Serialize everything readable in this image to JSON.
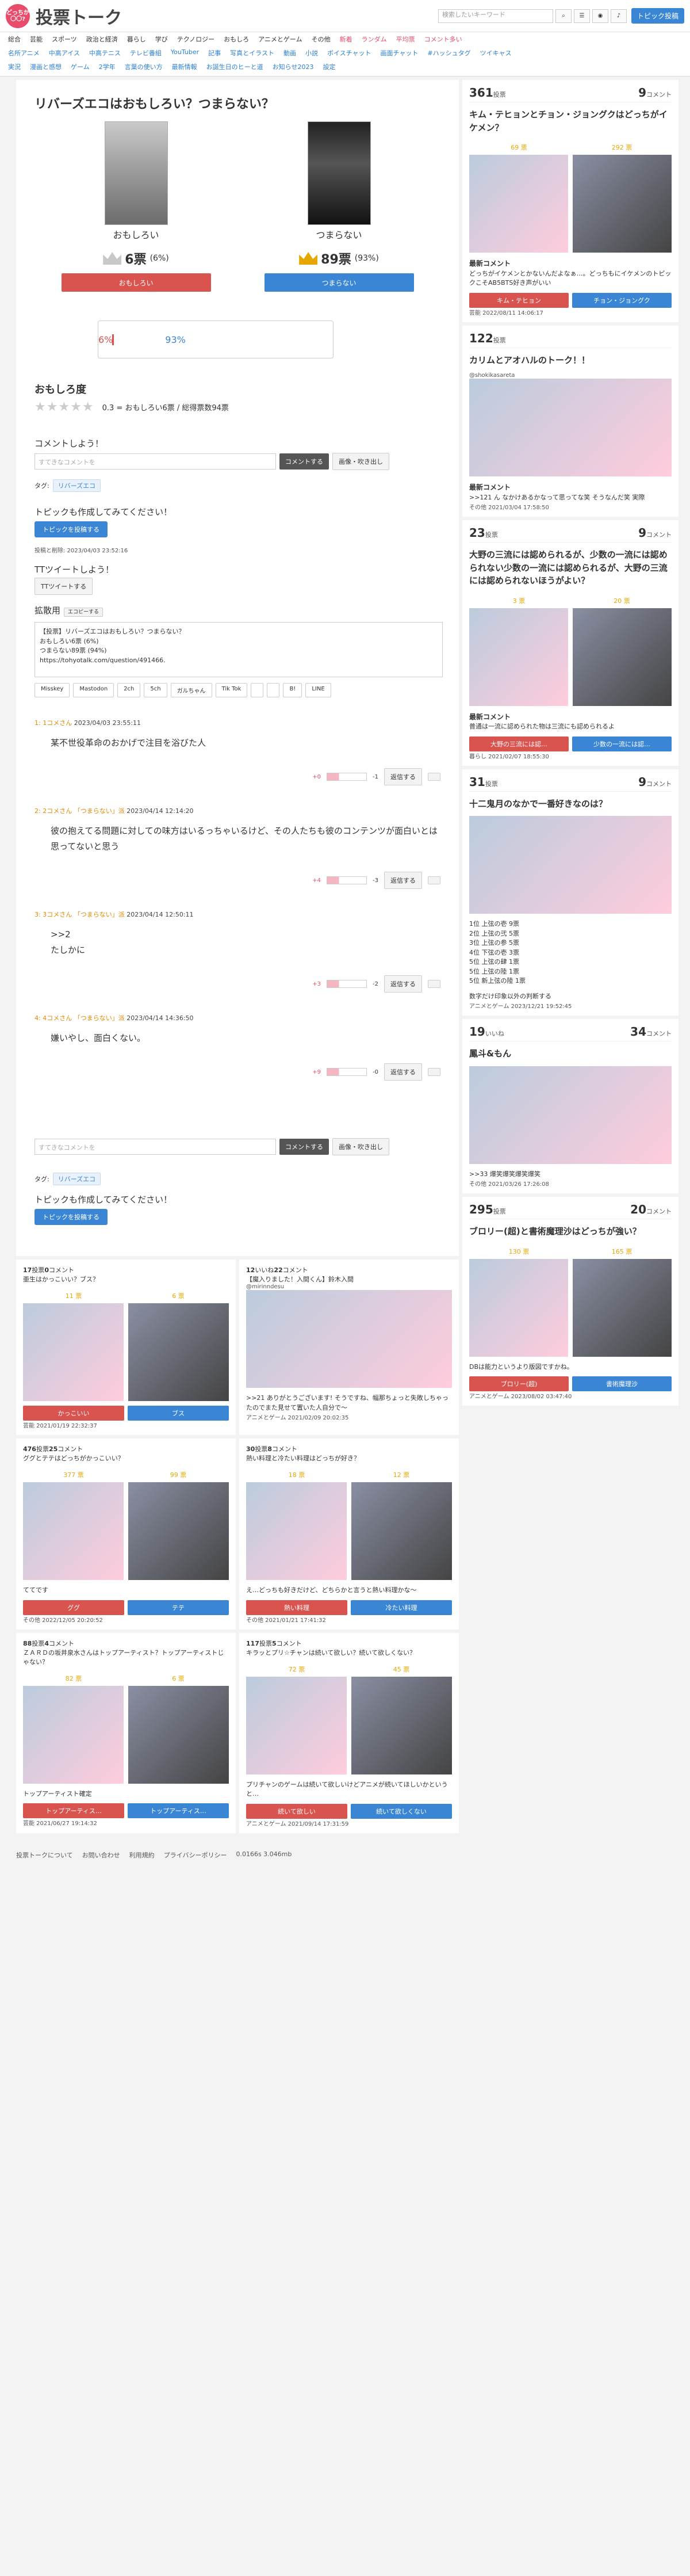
{
  "header": {
    "logo_badge": "どっちが〇〇?",
    "logo": "投票トーク",
    "search_placeholder": "検索したいキーワード",
    "post_button": "トピック投稿"
  },
  "nav": {
    "row1": [
      "総合",
      "芸能",
      "スポーツ",
      "政治と経済",
      "暮らし",
      "学び",
      "テクノロジー",
      "おもしろ",
      "アニメとゲーム",
      "その他",
      "新着",
      "ランダム",
      "平均票",
      "コメント多い"
    ],
    "row2": [
      "名所アニメ",
      "中高アイス",
      "中高テニス",
      "テレビ番組",
      "YouTuber",
      "記事",
      "写真とイラスト",
      "動画",
      "小説",
      "ボイスチャット",
      "画面チャット",
      "#ハッシュタグ",
      "ツイキャス"
    ],
    "row3": [
      "実況",
      "漫画と感想",
      "ゲーム",
      "2学年",
      "言葉の使い方",
      "最新情報",
      "お誕生日のヒーと道",
      "お知らせ2023",
      "設定"
    ]
  },
  "topic": {
    "title": "リバーズエコはおもしろい？つまらない？",
    "option_a": {
      "name": "おもしろい",
      "votes": "6票",
      "pct": "(6%)",
      "button": "おもしろい"
    },
    "option_b": {
      "name": "つまらない",
      "votes": "89票",
      "pct": "(93%)",
      "button": "つまらない"
    },
    "bar_a": "6%",
    "bar_b": "93%",
    "rating_heading": "おもしろ度",
    "stars": "★★★★★",
    "rating_text": "0.3 = おもしろい6票 / 総得票数94票",
    "comment_heading": "コメントしよう！",
    "comment_placeholder": "すてきなコメントを",
    "comment_button": "コメントする",
    "image_button": "画像・吹き出し",
    "tag_label": "タグ:",
    "tag": "リバーズエコ",
    "create_heading": "トピックも作成してみてください！",
    "create_button": "トピックを投稿する",
    "post_meta": "投稿と削除: 2023/04/03 23:52:16",
    "tweet_heading": "TTツイートしよう！",
    "tweet_button": "TTツイートする",
    "share_heading": "拡散用",
    "share_button": "エコピーする",
    "embed_text": "【投票】リバーズエコはおもしろい？つまらない？\nおもしろい6票 (6%)\nつまらない89票 (94%)\nhttps://tohyotalk.com/question/491466.",
    "shares": [
      "Misskey",
      "Mastodon",
      "2ch",
      "5ch",
      "ガルちゃん",
      "Tik Tok",
      "",
      "",
      "B!",
      "LINE"
    ]
  },
  "comments": [
    {
      "num": "1:",
      "author": "1コメさん",
      "date": "2023/04/03 23:55:11",
      "body": "某不世役革命のおかげで注目を浴びた人",
      "plus": "+0",
      "minus": "-1",
      "reply": "返信する"
    },
    {
      "num": "2:",
      "author": "2コメさん",
      "side": "「つまらない」派",
      "date": "2023/04/14 12:14:20",
      "body": "彼の抱えてる問題に対しての味方はいるっちゃいるけど、その人たちも彼のコンテンツが面白いとは思ってないと思う",
      "plus": "+4",
      "minus": "-3",
      "reply": "返信する"
    },
    {
      "num": "3:",
      "author": "3コメさん",
      "side": "「つまらない」派",
      "date": "2023/04/14 12:50:11",
      "body": ">>2\nたしかに",
      "plus": "+3",
      "minus": "-2",
      "reply": "返信する"
    },
    {
      "num": "4:",
      "author": "4コメさん",
      "side": "「つまらない」派",
      "date": "2023/04/14 14:36:50",
      "body": "嫌いやし、面白くない。",
      "plus": "+9",
      "minus": "-0",
      "reply": "返信する"
    }
  ],
  "side_cards": [
    {
      "votes": "361",
      "votes_label": "投票",
      "comments": "9",
      "comments_label": "コメント",
      "title": "キム・テヒョンとチョン・ジョングクはどっちがイケメン？",
      "a_votes": "69 票",
      "b_votes": "292 票",
      "a": "キム・テヒョン",
      "b": "チョン・ジョングク",
      "latest_label": "最新コメント",
      "latest": "どっちがイケメンとかないんだよなぁ…。どっちもにイケメンのトピックこそAB5BTS好き声がいい",
      "date": "芸能 2022/08/11 14:06:17"
    },
    {
      "votes": "122",
      "votes_label": "投票",
      "title": "カリムとアオハルのトーク！！",
      "author": "@shokikasareta",
      "latest_label": "最新コメント",
      "latest": ">>121 ん なかけあるかなって思ってな笑 そうなんだ笑 実際",
      "date": "その他 2021/03/04 17:58:50"
    },
    {
      "votes": "23",
      "votes_label": "投票",
      "comments": "9",
      "comments_label": "コメント",
      "title": "大野の三流には認められるが、少数の一流には認められない少数の一流には認められるが、大野の三流には認められないほうがよい？",
      "a_votes": "3 票",
      "b_votes": "20 票",
      "latest_label": "最新コメント",
      "latest": "普通は一流に認められた物は三流にも認められるよ",
      "a": "大野の三流には認…",
      "b": "少数の一流には認…",
      "date": "暮らし 2021/02/07 18:55:30"
    },
    {
      "votes": "31",
      "votes_label": "投票",
      "comments": "9",
      "comments_label": "コメント",
      "title": "十二鬼月のなかで一番好きなのは？",
      "list": [
        "1位 上弦の壱 9票",
        "2位 上弦の弐 5票",
        "3位 上弦の参 5票",
        "4位 下弦の壱 3票",
        "5位 上弦の肆 1票",
        "5位 上弦の陸 1票",
        "5位 新上弦の陸 1票"
      ],
      "latest": "数字だけ印象以外の判断する",
      "date": "アニメとゲーム 2023/12/21 19:52:45"
    },
    {
      "votes": "19",
      "votes_label": "いいね",
      "comments": "34",
      "comments_label": "コメント",
      "title": "鳳斗&もん",
      "latest": ">>33 爆笑爆笑爆笑爆笑",
      "date": "その他 2021/03/26 17:26:08"
    },
    {
      "votes": "295",
      "votes_label": "投票",
      "comments": "20",
      "comments_label": "コメント",
      "title": "ブロリー(超)と書術魔理沙はどっちが強い？",
      "a_votes": "130 票",
      "b_votes": "165 票",
      "latest": "DBは能力というより版図ですかね。",
      "a": "ブロリー(超)",
      "b": "書術魔理沙",
      "date": "アニメとゲーム 2023/08/02 03:47:40"
    }
  ],
  "grid": [
    {
      "votes": "17",
      "votes_label": "投票",
      "comments": "0",
      "comments_label": "コメント",
      "title": "亜生はかっこいい？ブス？",
      "a_votes": "11 票",
      "b_votes": "6 票",
      "a": "かっこいい",
      "b": "ブス",
      "date": "芸能 2021/01/19 22:32:37"
    },
    {
      "votes": "12",
      "votes_label": "いいね",
      "comments": "22",
      "comments_label": "コメント",
      "title": "【魔入りました！入間くん】鈴木入間",
      "author": "@mirinndesu",
      "latest": ">>21 ありがとうございます! そうですね、幅那ちょっと失敗しちゃったのでまた見せて置いた人自分で〜",
      "date": "アニメとゲーム 2021/02/09 20:02:35"
    },
    {
      "votes": "476",
      "votes_label": "投票",
      "comments": "25",
      "comments_label": "コメント",
      "title": "ググとテテはどっちがかっこいい？",
      "a_votes": "377 票",
      "b_votes": "99 票",
      "latest": "ててです",
      "a": "ググ",
      "b": "テテ",
      "date": "その他 2022/12/05 20:20:52"
    },
    {
      "votes": "30",
      "votes_label": "投票",
      "comments": "8",
      "comments_label": "コメント",
      "title": "熱い料理と冷たい料理はどっちが好き？",
      "a_votes": "18 票",
      "b_votes": "12 票",
      "latest": "え…どっちも好きだけど、どちらかと言うと熱い料理かな〜",
      "a": "熱い料理",
      "b": "冷たい料理",
      "date": "その他 2021/01/21 17:41:32"
    },
    {
      "votes": "88",
      "votes_label": "投票",
      "comments": "4",
      "comments_label": "コメント",
      "title": "ＺＡＲＤの坂井泉水さんはトップアーティスト？トップアーティストじゃない？",
      "a_votes": "82 票",
      "b_votes": "6 票",
      "latest": "トップアーティスト確定",
      "a": "トップアーティス…",
      "b": "トップアーティス…",
      "date": "芸能 2021/06/27 19:14:32"
    },
    {
      "votes": "117",
      "votes_label": "投票",
      "comments": "5",
      "comments_label": "コメント",
      "title": "キラッとプリ☆チャンは続いて欲しい？続いて欲しくない？",
      "a_votes": "72 票",
      "b_votes": "45 票",
      "latest": "プリチャンのゲームは続いて欲しいけどアニメが続いてほしいかというと…",
      "a": "続いて欲しい",
      "b": "続いて欲しくない",
      "date": "アニメとゲーム 2021/09/14 17:31:59"
    }
  ],
  "footer": [
    "投票トークについて",
    "お問い合わせ",
    "利用規約",
    "プライバシーポリシー",
    "0.0166s 3.046mb"
  ]
}
